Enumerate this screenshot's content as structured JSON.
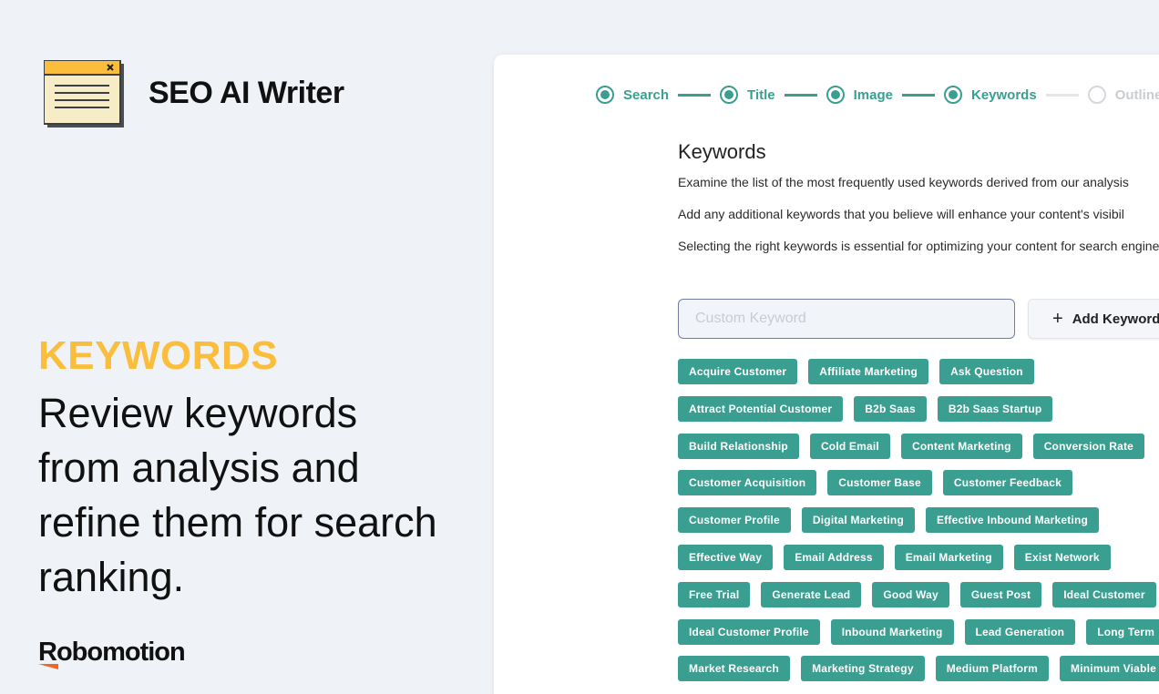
{
  "brand": {
    "title": "SEO AI Writer",
    "icon": "document-window-icon"
  },
  "feature": {
    "heading": "KEYWORDS",
    "description": "Review keywords from analysis and refine them for search ranking."
  },
  "footer": {
    "logo_text": "Robomotion"
  },
  "colors": {
    "accent_teal": "#3a9e91",
    "heading_yellow": "#fbbd3c",
    "logo_orange": "#f26522"
  },
  "stepper": {
    "steps": [
      {
        "label": "Search",
        "state": "done"
      },
      {
        "label": "Title",
        "state": "done"
      },
      {
        "label": "Image",
        "state": "done"
      },
      {
        "label": "Keywords",
        "state": "current"
      },
      {
        "label": "Outline",
        "state": "pending"
      }
    ]
  },
  "keywords_panel": {
    "title": "Keywords",
    "paragraphs": [
      "Examine the list of the most frequently used keywords derived from our analysis",
      "Add any additional keywords that you believe will enhance your content's visibil",
      "Selecting the right keywords is essential for optimizing your content for search engines."
    ],
    "input_placeholder": "Custom Keyword",
    "input_value": "",
    "add_button_label": "Add Keyword",
    "tag_rows": [
      [
        "Acquire Customer",
        "Affiliate Marketing",
        "Ask Question"
      ],
      [
        "Attract Potential Customer",
        "B2b Saas",
        "B2b Saas Startup"
      ],
      [
        "Build Relationship",
        "Cold Email",
        "Content Marketing",
        "Conversion Rate"
      ],
      [
        "Customer Acquisition",
        "Customer Base",
        "Customer Feedback"
      ],
      [
        "Customer Profile",
        "Digital Marketing",
        "Effective Inbound Marketing"
      ],
      [
        "Effective Way",
        "Email Address",
        "Email Marketing",
        "Exist Network"
      ],
      [
        "Free Trial",
        "Generate Lead",
        "Good Way",
        "Guest Post",
        "Ideal Customer"
      ],
      [
        "Ideal Customer Profile",
        "Inbound Marketing",
        "Lead Generation",
        "Long Term"
      ],
      [
        "Market Research",
        "Marketing Strategy",
        "Medium Platform",
        "Minimum Viable"
      ]
    ]
  }
}
